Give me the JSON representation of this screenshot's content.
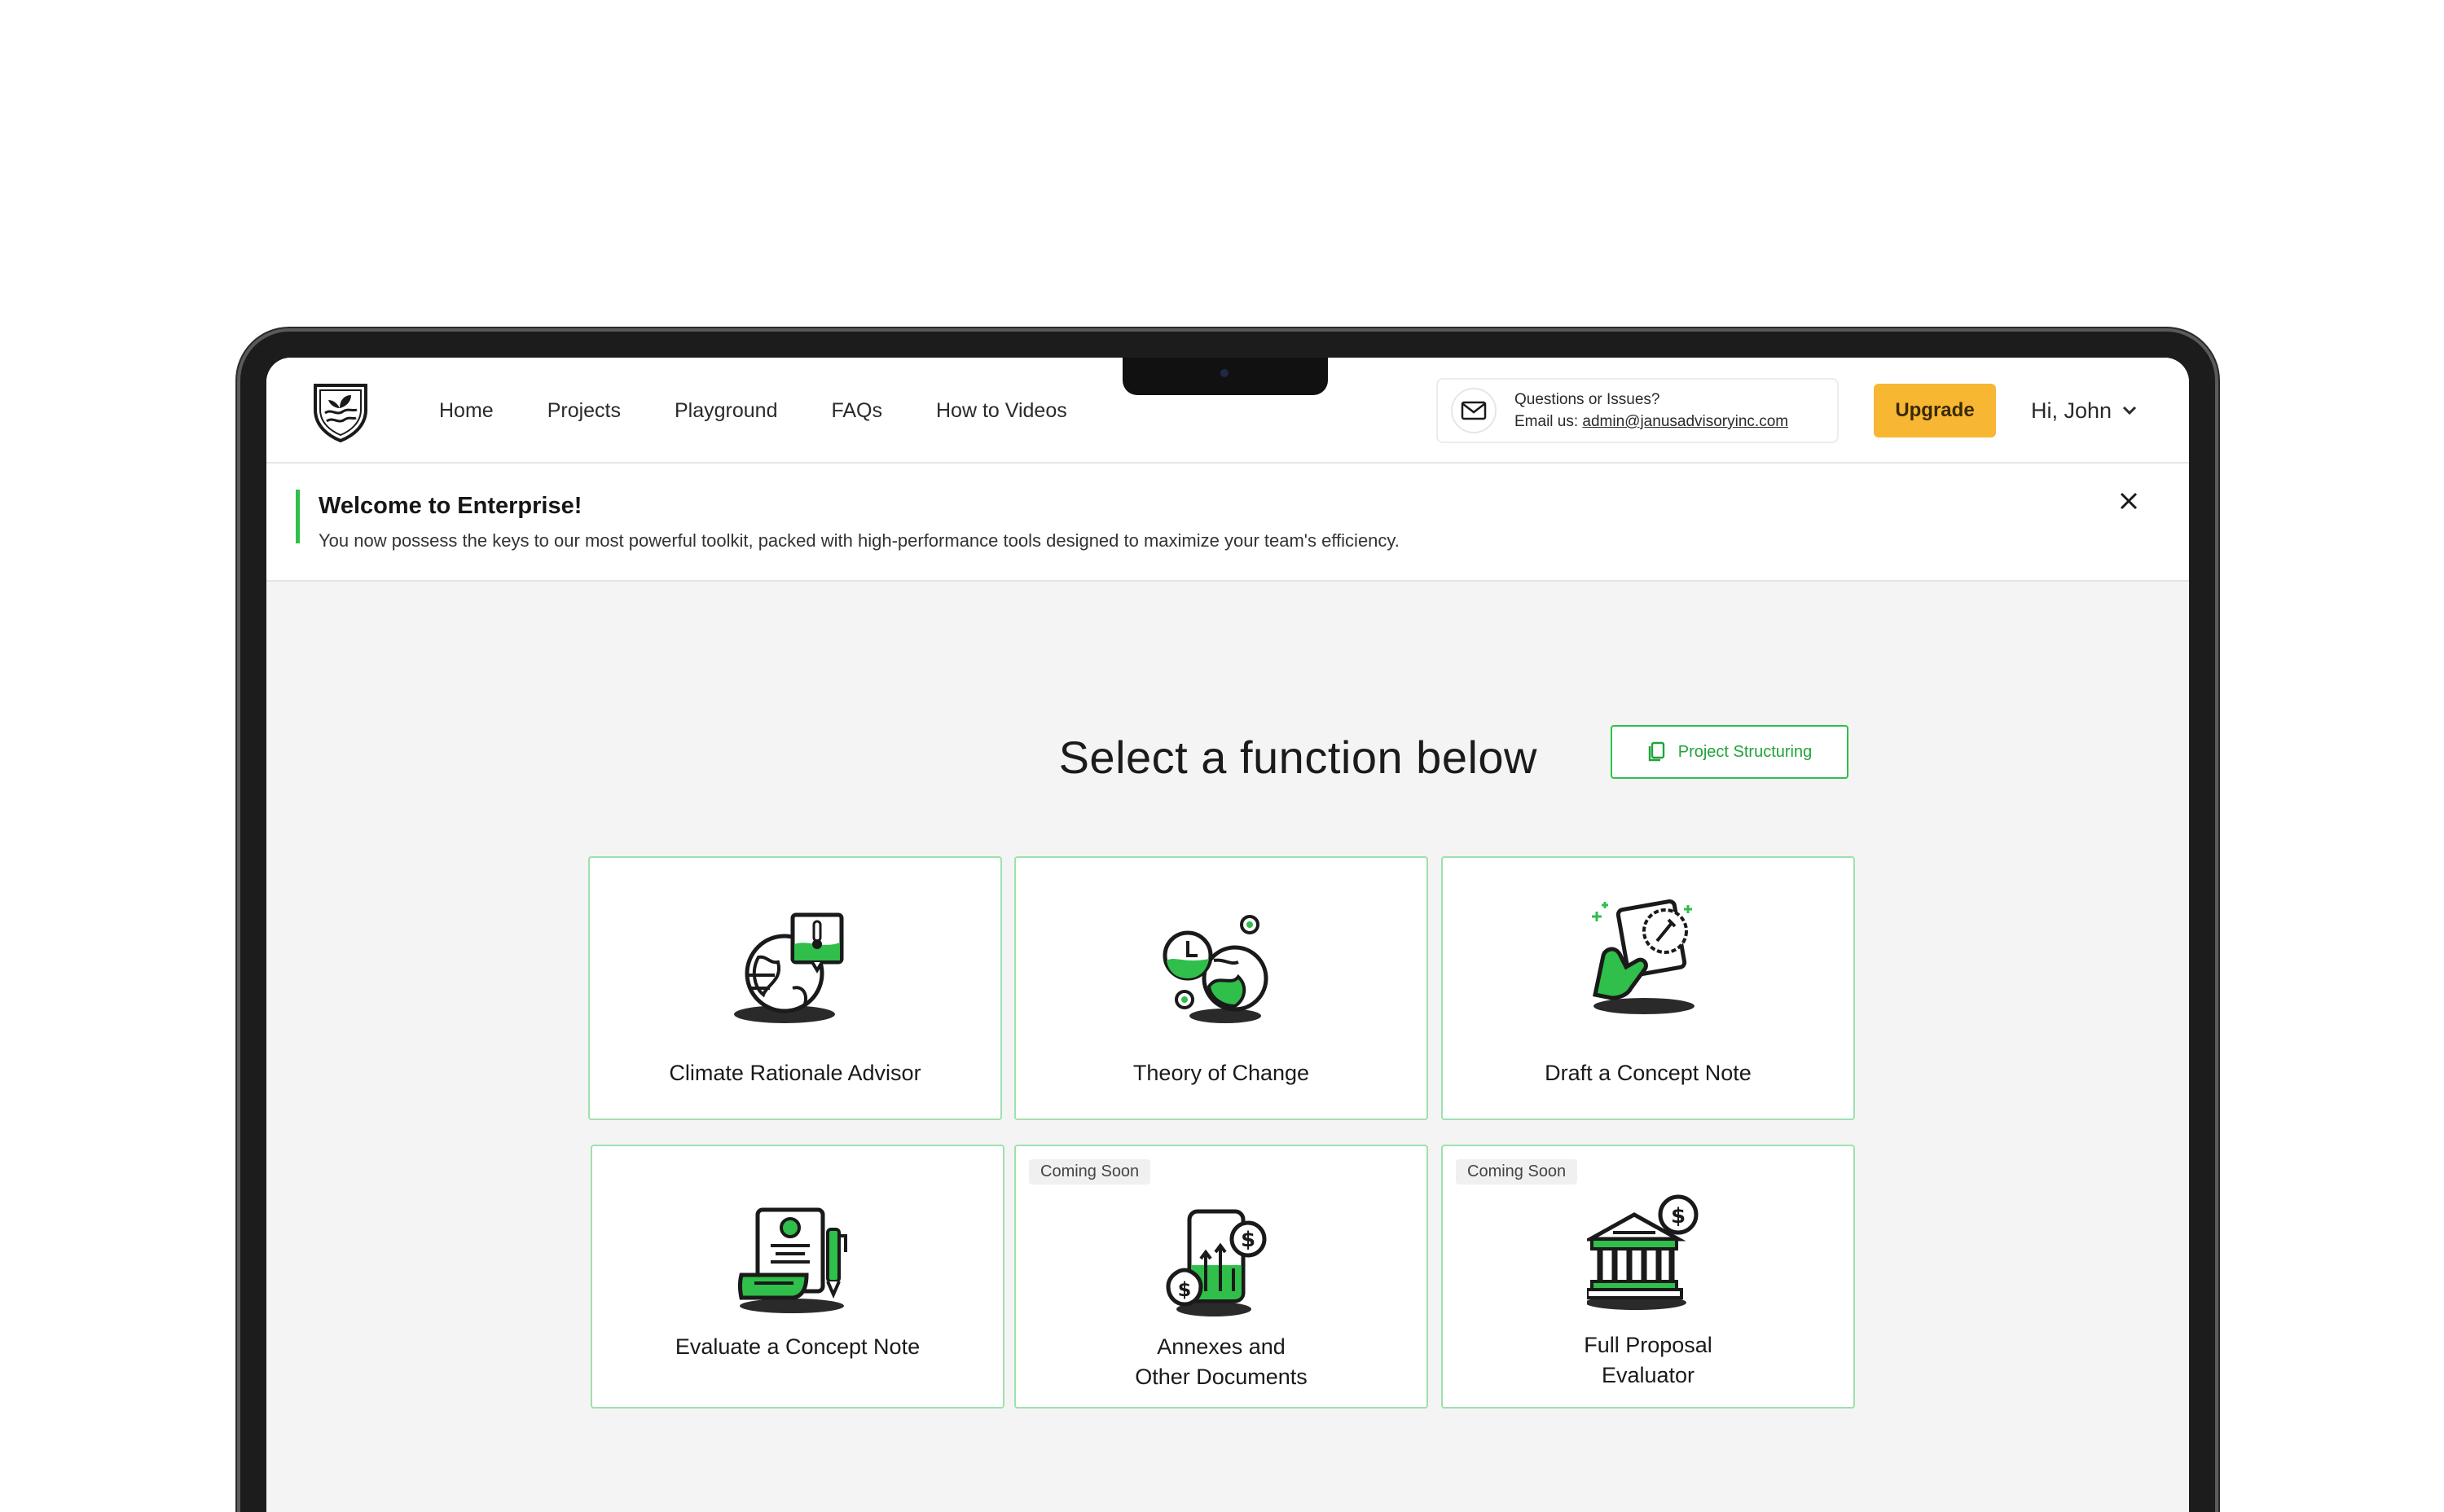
{
  "nav": {
    "links": [
      "Home",
      "Projects",
      "Playground",
      "FAQs",
      "How to Videos"
    ],
    "contact_title": "Questions or Issues?",
    "contact_prefix": "Email us: ",
    "contact_email": "admin@janusadvisoryinc.com",
    "upgrade_label": "Upgrade",
    "user_greeting": "Hi, John"
  },
  "banner": {
    "title": "Welcome to Enterprise!",
    "text": "You now possess the keys to our most powerful toolkit, packed with high-performance tools designed to maximize your team's efficiency."
  },
  "main": {
    "heading": "Select a function below",
    "project_structuring_label": "Project Structuring",
    "cards": [
      {
        "label": "Climate Rationale Advisor",
        "badge": ""
      },
      {
        "label": "Theory of Change",
        "badge": ""
      },
      {
        "label": "Draft a Concept Note",
        "badge": ""
      },
      {
        "label": "Evaluate a Concept Note",
        "badge": ""
      },
      {
        "label_line1": "Annexes and",
        "label_line2": "Other Documents",
        "badge": "Coming Soon"
      },
      {
        "label_line1": "Full Proposal",
        "label_line2": "Evaluator",
        "badge": "Coming Soon"
      }
    ]
  },
  "colors": {
    "accent_green": "#2fbf4a",
    "upgrade_yellow": "#f7b733",
    "card_border": "#9fe0ac"
  },
  "icons": [
    "shield-logo-icon",
    "mail-icon",
    "chevron-down-icon",
    "close-icon",
    "document-icon",
    "globe-thermometer-icon",
    "theory-change-icon",
    "document-badge-hand-icon",
    "certificate-pen-icon",
    "phone-money-icon",
    "bank-dollar-icon"
  ]
}
